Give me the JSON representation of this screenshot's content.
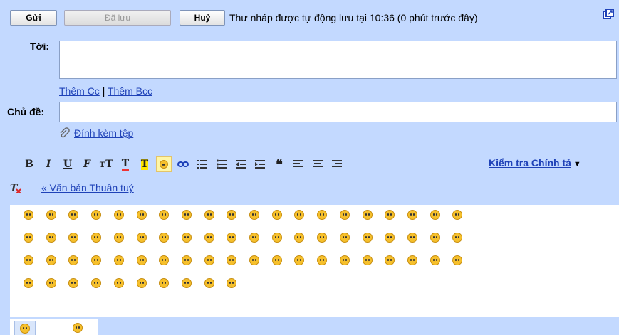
{
  "toolbar": {
    "send_label": "Gửi",
    "saved_label": "Đã lưu",
    "cancel_label": "Huỷ",
    "status_text": "Thư nháp được tự động lưu tại 10:36 (0 phút trước đây)"
  },
  "compose": {
    "to_label": "Tới:",
    "to_value": "",
    "add_cc": "Thêm Cc",
    "separator": "|",
    "add_bcc": "Thêm Bcc",
    "subject_label": "Chủ đề:",
    "subject_value": "",
    "attach_label": "Đính kèm tệp"
  },
  "format_bar": {
    "buttons": [
      "bold-icon",
      "italic-icon",
      "underline-icon",
      "font-icon",
      "font-size-icon",
      "text-color-icon",
      "highlight-icon",
      "emoticon-icon",
      "link-icon",
      "numbered-list-icon",
      "bulleted-list-icon",
      "outdent-icon",
      "indent-icon",
      "quote-icon",
      "align-left-icon",
      "align-center-icon",
      "align-right-icon"
    ],
    "spell_check_label": "Kiểm tra Chính tả",
    "plain_text_label": "« Văn bản Thuần tuý"
  },
  "emoticons": {
    "rows": [
      20,
      20,
      20,
      10
    ],
    "colors": [
      "#f6c02c",
      "#f6c02c",
      "#f6c02c",
      "#f6c02c",
      "#f6c02c",
      "#f6c02c",
      "#f6c02c",
      "#f6c02c",
      "#f6c02c",
      "#f6c02c",
      "#f6c02c",
      "#f6c02c",
      "#f6c02c",
      "#f6c02c",
      "#f6c02c",
      "#f6c02c",
      "#f6c02c",
      "#f6c02c",
      "#f6c02c",
      "#f6c02c"
    ]
  },
  "colors": {
    "background": "#c3d9ff",
    "link": "#1f42b8"
  }
}
